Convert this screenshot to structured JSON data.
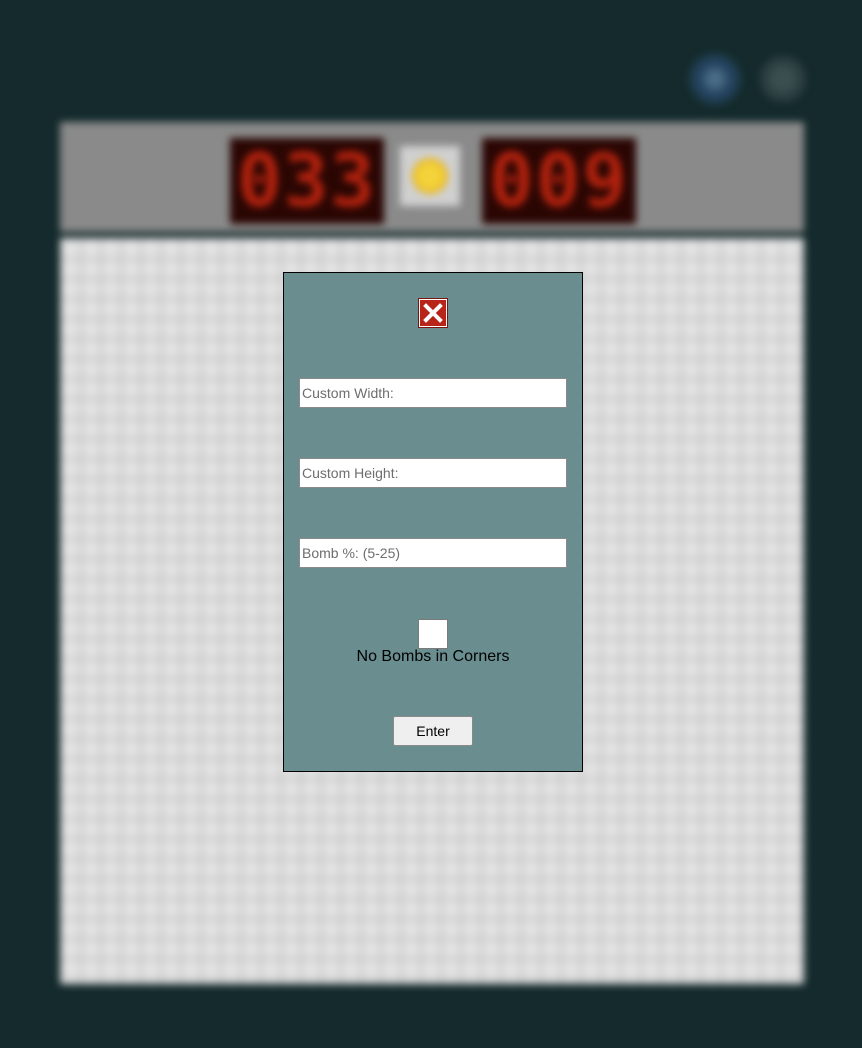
{
  "header": {
    "icons": [
      "settings-icon",
      "info-icon"
    ]
  },
  "status": {
    "bomb_count": "033",
    "timer": "009",
    "face": "sun-face-icon"
  },
  "modal": {
    "close_icon": "close-x-icon",
    "width_placeholder": "Custom Width:",
    "height_placeholder": "Custom Height:",
    "bomb_placeholder": "Bomb %: (5-25)",
    "corners_label": "No Bombs in Corners",
    "enter_label": "Enter"
  },
  "colors": {
    "page_bg": "#142a2c",
    "modal_bg": "#6a8e8f",
    "close_red": "#b8231a",
    "counter_red": "#b4220e"
  }
}
